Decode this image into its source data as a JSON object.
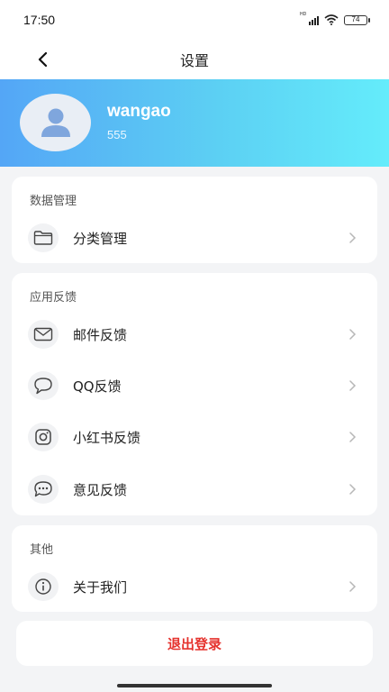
{
  "status_bar": {
    "time": "17:50",
    "network": "HD",
    "battery": "74"
  },
  "nav": {
    "title": "设置",
    "back_icon": "chevron-left-icon"
  },
  "profile": {
    "username": "wangao",
    "user_id": "555",
    "avatar_icon": "user-icon",
    "gradient": [
      "#54a6f6",
      "#64ecfb"
    ]
  },
  "sections": {
    "data": {
      "title": "数据管理",
      "items": [
        {
          "label": "分类管理",
          "icon": "folder-icon"
        }
      ]
    },
    "feedback": {
      "title": "应用反馈",
      "items": [
        {
          "label": "邮件反馈",
          "icon": "mail-icon"
        },
        {
          "label": "QQ反馈",
          "icon": "chat-bubble-icon"
        },
        {
          "label": "小红书反馈",
          "icon": "instagram-icon"
        },
        {
          "label": "意见反馈",
          "icon": "comment-dots-icon"
        }
      ]
    },
    "other": {
      "title": "其他",
      "items": [
        {
          "label": "关于我们",
          "icon": "info-icon"
        }
      ]
    }
  },
  "logout": {
    "label": "退出登录",
    "color": "#e5322d"
  }
}
